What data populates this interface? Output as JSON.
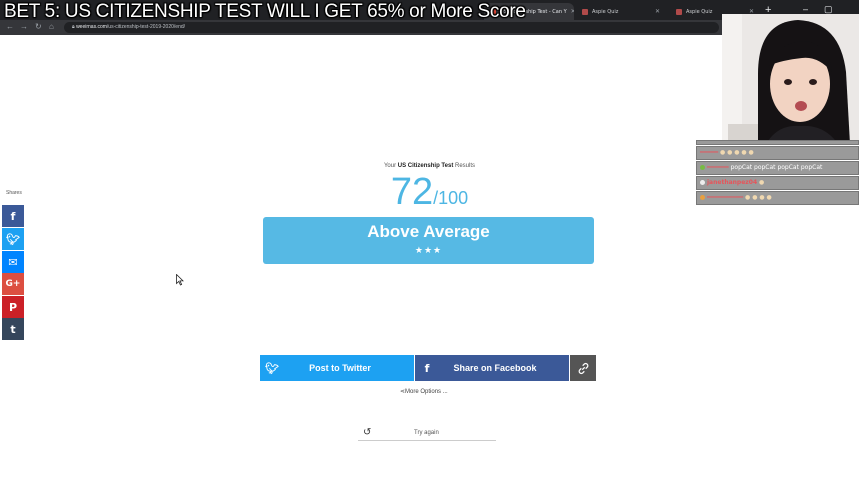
{
  "stream_overlay": {
    "title": "BET 5: US CITIZENSHIP TEST WILL I GET 65% or More Score"
  },
  "browser": {
    "tabs": [
      {
        "label": "US Citizenship Test - Can Y"
      },
      {
        "label": "Aspie Quiz"
      },
      {
        "label": "Aspie Quiz"
      }
    ],
    "url": {
      "domain": "weeirnas.com",
      "path": "/us-citizenship-test-2019-2020/end/"
    }
  },
  "share_sidebar": {
    "count_label": "Shares",
    "buttons": [
      {
        "network": "facebook",
        "glyph": "f",
        "color": "#3b5998"
      },
      {
        "network": "twitter",
        "glyph": "t",
        "color": "#1da1f2"
      },
      {
        "network": "messenger",
        "glyph": "m",
        "color": "#0084ff"
      },
      {
        "network": "google-plus",
        "glyph": "G+",
        "color": "#dc4e41"
      },
      {
        "network": "pinterest",
        "glyph": "P",
        "color": "#cb2027"
      },
      {
        "network": "tumblr",
        "glyph": "t",
        "color": "#35465c"
      }
    ]
  },
  "result": {
    "label_prefix": "Your",
    "label_strong": "US Citizenship Test",
    "label_suffix": "Results",
    "score": "72",
    "score_max": "/100",
    "verdict": "Above Average",
    "stars": "★★★"
  },
  "actions": {
    "twitter_label": "Post to Twitter",
    "facebook_label": "Share on Facebook",
    "more_options": "More Options ...",
    "try_again": "Try again"
  },
  "chat": {
    "messages": [
      {
        "user": "",
        "text": ""
      },
      {
        "user": "",
        "text": "popCat popCat popCat popCat"
      },
      {
        "user": "janethanpez04",
        "text": ""
      },
      {
        "user": "",
        "text": ""
      }
    ]
  },
  "colors": {
    "accent": "#56b9e4",
    "score": "#4db6e3",
    "twitter": "#1da1f2",
    "facebook": "#3b5998"
  }
}
